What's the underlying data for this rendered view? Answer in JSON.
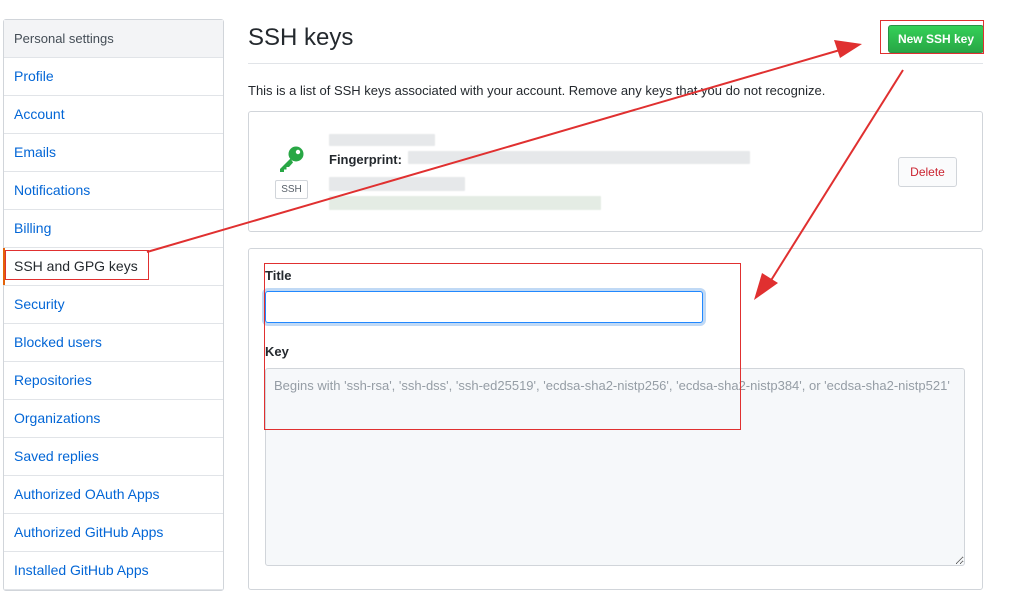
{
  "sidebar": {
    "header": "Personal settings",
    "items": [
      {
        "label": "Profile"
      },
      {
        "label": "Account"
      },
      {
        "label": "Emails"
      },
      {
        "label": "Notifications"
      },
      {
        "label": "Billing"
      },
      {
        "label": "SSH and GPG keys",
        "selected": true
      },
      {
        "label": "Security"
      },
      {
        "label": "Blocked users"
      },
      {
        "label": "Repositories"
      },
      {
        "label": "Organizations"
      },
      {
        "label": "Saved replies"
      },
      {
        "label": "Authorized OAuth Apps"
      },
      {
        "label": "Authorized GitHub Apps"
      },
      {
        "label": "Installed GitHub Apps"
      }
    ]
  },
  "main": {
    "title": "SSH keys",
    "new_key_button": "New SSH key",
    "intro": "This is a list of SSH keys associated with your account. Remove any keys that you do not recognize.",
    "key": {
      "icon": "key-icon",
      "badge": "SSH",
      "fingerprint_label": "Fingerprint:",
      "delete_button": "Delete"
    },
    "form": {
      "title_label": "Title",
      "title_value": "",
      "key_label": "Key",
      "key_placeholder": "Begins with 'ssh-rsa', 'ssh-dss', 'ssh-ed25519', 'ecdsa-sha2-nistp256', 'ecdsa-sha2-nistp384', or 'ecdsa-sha2-nistp521'"
    }
  },
  "colors": {
    "link": "#0366d6",
    "primary_button": "#28a745",
    "danger": "#cb2431",
    "annotation": "#e03030",
    "key_icon": "#28a745"
  }
}
